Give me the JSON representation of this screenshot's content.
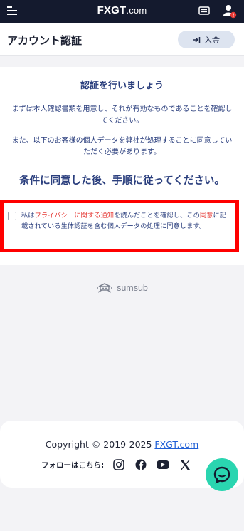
{
  "header": {
    "logo_text_fx": "FX",
    "logo_text_g": "GT",
    "logo_text_dot": ".com"
  },
  "titlebar": {
    "title": "アカウント認証",
    "deposit_label": "入金"
  },
  "verification": {
    "heading": "認証を行いましょう",
    "paragraph1": "まずは本人確認書類を用意し、それが有効なものであることを確認してください。",
    "paragraph2": "また、以下のお客様の個人データを弊社が処理することに同意していただく必要があります。",
    "sub_heading": "条件に同意した後、手順に従ってください。"
  },
  "consent": {
    "text_part1": "私は",
    "link1": "プライバシーに関する通知",
    "text_part2": "を読んだことを確認し、この",
    "link2": "同意",
    "text_part3": "に記載されている生体認証を含む個人データの処理に同意します。",
    "checked": false
  },
  "provider": {
    "name": "sumsub"
  },
  "footer": {
    "copyright": "Copyright © 2019-2025 ",
    "copyright_link": "FXGT.com",
    "follow_label": "フォローはこちら:"
  },
  "colors": {
    "topbar": "#141a2e",
    "accent_text": "#2b3f7e",
    "highlight_border": "#ff0000",
    "link_red": "#e53935",
    "chat": "#2ad5b0"
  },
  "icons": [
    "menu-icon",
    "ticket-icon",
    "user-alert-icon",
    "arrow-in-icon",
    "instagram-icon",
    "facebook-icon",
    "youtube-icon",
    "x-icon",
    "chat-icon",
    "sumsub-logo-icon"
  ]
}
